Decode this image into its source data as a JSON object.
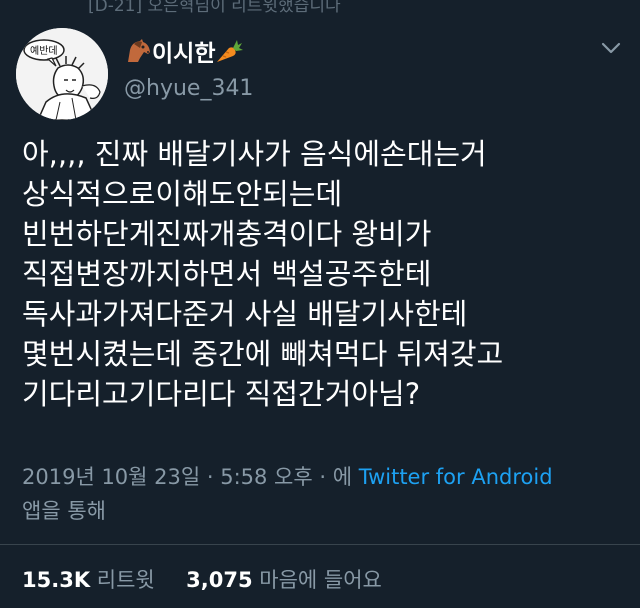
{
  "context": {
    "retweet_text": "[D-21] 오은혁님이 리트윗했습니다"
  },
  "user": {
    "display_name": "이시한",
    "handle": "@hyue_341",
    "avatar_label": "예반데"
  },
  "tweet": {
    "lines": [
      "아,,,, 진짜 배달기사가 음식에손대는거",
      "상식적으로이해도안되는데",
      "빈번하단게진짜개충격이다 왕비가",
      "직접변장까지하면서 백설공주한테",
      "독사과가져다준거 사실 배달기사한테",
      "몇번시켰는데 중간에 빼쳐먹다 뒤져갖고",
      "기다리고기다리다 직접간거아님?"
    ]
  },
  "meta": {
    "timestamp_prefix": "2019년 10월 23일 · 5:58 오후 · 에 ",
    "source": "Twitter for Android",
    "suffix": "앱을 통해"
  },
  "stats": {
    "retweets_count": "15.3K",
    "retweets_label": "리트윗",
    "likes_count": "3,075",
    "likes_label": "마음에 들어요"
  },
  "icons": {
    "chevron": "chevron-down-icon",
    "emoji_left": "horse-face-icon",
    "emoji_right": "carrot-icon"
  },
  "colors": {
    "background": "#15202b",
    "text": "#ffffff",
    "secondary": "#8899a6",
    "link": "#1da1f2",
    "divider": "#38444d"
  }
}
